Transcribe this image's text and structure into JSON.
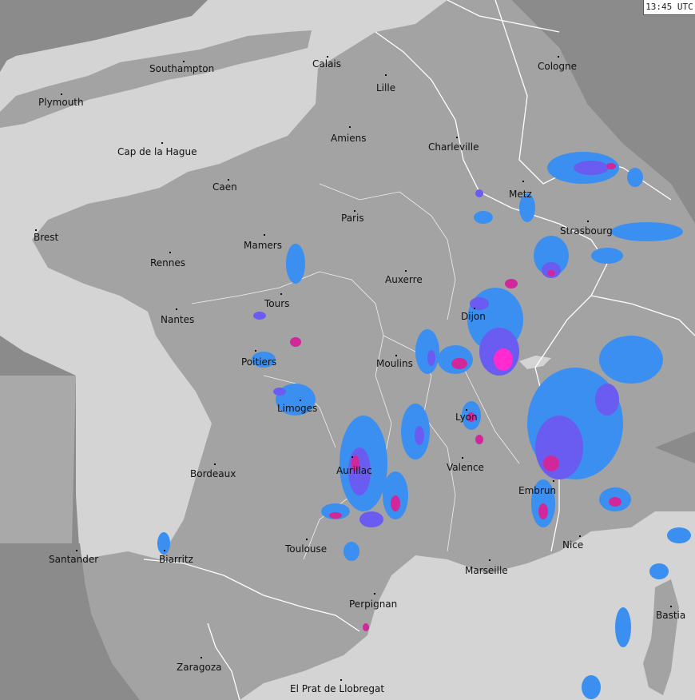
{
  "timestamp": "13:45 UTC",
  "colors": {
    "sea": "#d4d4d4",
    "coverage_land": "#a3a3a3",
    "outside_dark": "#8b8b8b",
    "outside_sea": "#a9a9a9",
    "borders": "#ffffff",
    "rain_light": "#3a8ff0",
    "rain_medium": "#6a5cf0",
    "rain_heavy": "#d0289a",
    "rain_extreme": "#ff2bd0"
  },
  "cities": [
    {
      "name": "Southampton"
    },
    {
      "name": "Calais"
    },
    {
      "name": "Cologne"
    },
    {
      "name": "Plymouth"
    },
    {
      "name": "Lille"
    },
    {
      "name": "Amiens"
    },
    {
      "name": "Charleville"
    },
    {
      "name": "Cap de la Hague"
    },
    {
      "name": "Caen"
    },
    {
      "name": "Metz"
    },
    {
      "name": "Paris"
    },
    {
      "name": "Brest"
    },
    {
      "name": "Strasbourg"
    },
    {
      "name": "Mamers"
    },
    {
      "name": "Rennes"
    },
    {
      "name": "Auxerre"
    },
    {
      "name": "Tours"
    },
    {
      "name": "Dijon"
    },
    {
      "name": "Nantes"
    },
    {
      "name": "Poitiers"
    },
    {
      "name": "Moulins"
    },
    {
      "name": "Limoges"
    },
    {
      "name": "Lyon"
    },
    {
      "name": "Valence"
    },
    {
      "name": "Aurillac"
    },
    {
      "name": "Bordeaux"
    },
    {
      "name": "Embrun"
    },
    {
      "name": "Nice"
    },
    {
      "name": "Toulouse"
    },
    {
      "name": "Santander"
    },
    {
      "name": "Biarritz"
    },
    {
      "name": "Marseille"
    },
    {
      "name": "Perpignan"
    },
    {
      "name": "Bastia"
    },
    {
      "name": "Zaragoza"
    },
    {
      "name": "El Prat de Llobregat"
    }
  ]
}
